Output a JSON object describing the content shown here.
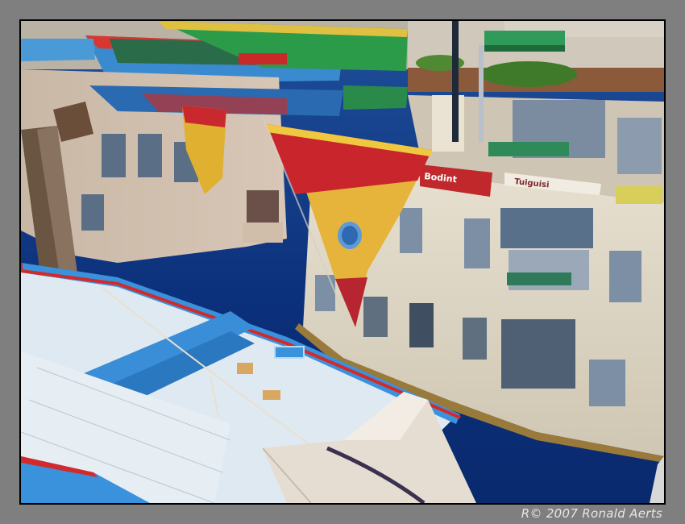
{
  "photo": {
    "alt": "Reflection of colourful boats and canal-side houses in water",
    "credit": "R© 2007 Ronald Aerts",
    "sign_text_1": "Bodint",
    "sign_text_2": "Tuiguisi",
    "colors": {
      "water": "#0e3a8a",
      "boat_blue": "#3a8fd8",
      "boat_red": "#d22a2a",
      "sail_red": "#c8282e",
      "sail_yellow": "#e2b53a",
      "wall": "#d9d2c0",
      "frame": "#7f7f7f"
    }
  }
}
